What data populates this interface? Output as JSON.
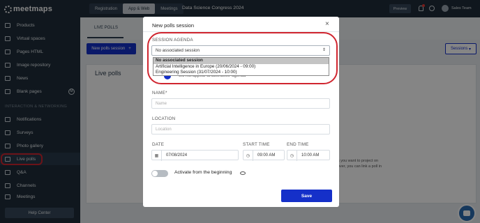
{
  "topbar": {
    "tabs": [
      "Registration",
      "App & Web",
      "Meetings"
    ],
    "event_title": "Data Science Congress 2024",
    "preview": "Preview",
    "user": "Sales Team"
  },
  "sidebar": {
    "logo": "meetmaps",
    "items": [
      "Products",
      "Virtual spaces",
      "Pages HTML",
      "Image repository",
      "News",
      "Blank pages"
    ],
    "blank_badge": "M",
    "section": "INTERACTION & NETWORKING",
    "items2": [
      "Notifications",
      "Surveys",
      "Photo gallery",
      "Live polls",
      "Q&A",
      "Channels",
      "Meetings"
    ],
    "help": "Help Center"
  },
  "main": {
    "subtab": "LIVE POLLS",
    "new_button": "New polls session",
    "sessions": "Sessions",
    "card_title": "Live polls",
    "card_text_1": "s you want to project on",
    "card_text_2": "over, you can link a poll in"
  },
  "modal": {
    "title": "New polls session",
    "close": "×",
    "agenda_label": "SESSION AGENDA",
    "agenda_value": "No associated session",
    "agenda_options": [
      "No associated session",
      "Artificial Intelligence in Europe (20/06/2024 - 09:00)",
      "Engineering Session (31/07/2024 - 10:00)"
    ],
    "agenda_hint": "will not appear at attendees' agenda",
    "name_label": "NAME*",
    "name_placeholder": "Name",
    "location_label": "LOCATION",
    "location_placeholder": "Location",
    "date_label": "DATE",
    "date_value": "07/08/2024",
    "start_label": "START TIME",
    "start_value": "09:00 AM",
    "end_label": "END TIME",
    "end_value": "10:00 AM",
    "activate_label": "Activate from the beginning",
    "save": "Save"
  }
}
